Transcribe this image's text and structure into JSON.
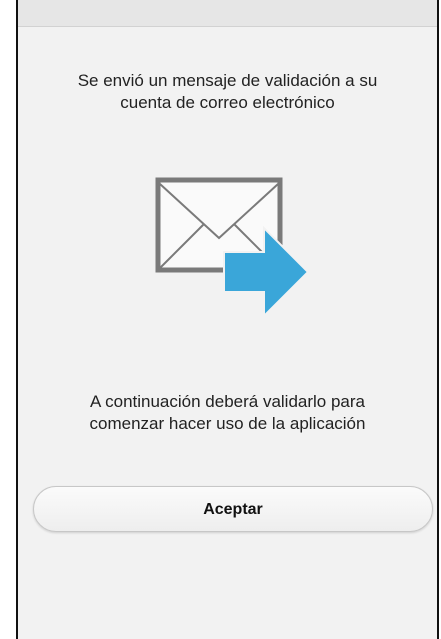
{
  "dialog": {
    "message_sent": "Se envió un mensaje de validación a su\ncuenta de correo electrónico",
    "instruction": "A continuación deberá validarlo para\ncomenzar hacer uso de la aplicación",
    "accept_label": "Aceptar",
    "icon": "mail-send-icon"
  },
  "colors": {
    "background": "#f2f2f2",
    "envelope_border": "#7a7a7a",
    "arrow": "#3aa6d9",
    "text": "#222222"
  }
}
